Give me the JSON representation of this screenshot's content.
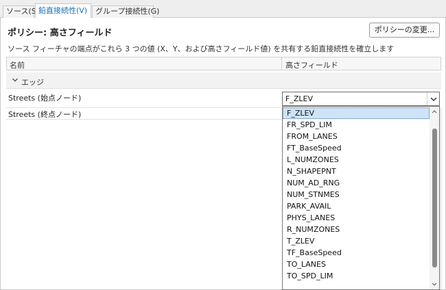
{
  "tabs": [
    {
      "label": "ソース(S)"
    },
    {
      "label": "鉛直接続性(V)"
    },
    {
      "label": "グループ接続性(G)"
    }
  ],
  "policy": {
    "title": "ポリシー: 高さフィールド",
    "change_button": "ポリシーの変更...",
    "description": "ソース フィーチャの端点がこれら 3 つの値 (X、Y、および高さフィールド値) を共有する鉛直接続性を確立します"
  },
  "grid": {
    "col_name": "名前",
    "col_height": "高さフィールド",
    "group_label": "エッジ",
    "rows": [
      {
        "label": "Streets (始点ノード)"
      },
      {
        "label": "Streets (終点ノード)"
      }
    ]
  },
  "combo": {
    "value": "F_ZLEV",
    "icon": "chevron-down-icon"
  },
  "dropdown": {
    "items": [
      "F_ZLEV",
      "FR_SPD_LIM",
      "FROM_LANES",
      "FT_BaseSpeed",
      "L_NUMZONES",
      "N_SHAPEPNT",
      "NUM_AD_RNG",
      "NUM_STNMES",
      "PARK_AVAIL",
      "PHYS_LANES",
      "R_NUMZONES",
      "T_ZLEV",
      "TF_BaseSpeed",
      "TO_LANES",
      "TO_SPD_LIM"
    ],
    "selected_index": 0
  },
  "colors": {
    "active_tab_text": "#1a70b8",
    "selection_bg": "#cfe3f7"
  }
}
